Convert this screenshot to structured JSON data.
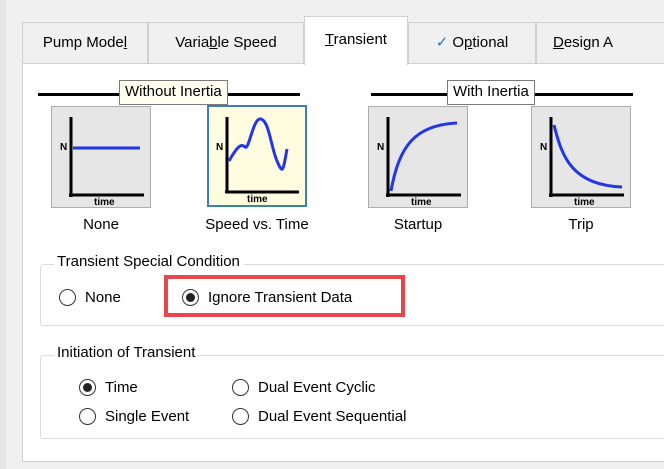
{
  "tabs": [
    {
      "label_pre": "Pump Mode",
      "label_u": "l",
      "label_post": ""
    },
    {
      "label_pre": "Varia",
      "label_u": "b",
      "label_post": "le Speed"
    },
    {
      "label_pre": "",
      "label_u": "T",
      "label_post": "ransient"
    },
    {
      "label_pre": "O",
      "label_u": "p",
      "label_post": "tional",
      "checked": true
    },
    {
      "label_pre": "",
      "label_u": "D",
      "label_post": "esign A"
    }
  ],
  "sections": {
    "without_inertia": "Without Inertia",
    "with_inertia": "With Inertia"
  },
  "graph_buttons": [
    {
      "caption": "None",
      "axis_y": "N",
      "axis_x": "time",
      "curve": "flat",
      "selected": false
    },
    {
      "caption": "Speed vs. Time",
      "axis_y": "N",
      "axis_x": "time",
      "curve": "wave",
      "selected": true
    },
    {
      "caption": "Startup",
      "axis_y": "N",
      "axis_x": "time",
      "curve": "rise",
      "selected": false
    },
    {
      "caption": "Trip",
      "axis_y": "N",
      "axis_x": "time",
      "curve": "decay",
      "selected": false
    }
  ],
  "special_condition": {
    "title": "Transient Special Condition",
    "options": [
      {
        "label": "None",
        "checked": false
      },
      {
        "label": "Ignore Transient Data",
        "checked": true
      }
    ]
  },
  "initiation": {
    "title": "Initiation of Transient",
    "options": [
      {
        "label": "Time",
        "checked": true
      },
      {
        "label": "Single Event",
        "checked": false
      },
      {
        "label": "Dual Event Cyclic",
        "checked": false
      },
      {
        "label": "Dual Event Sequential",
        "checked": false
      }
    ]
  },
  "colors": {
    "curve": "#2336e8",
    "highlight": "#e8464c",
    "selected_border": "#3c7fb1"
  }
}
